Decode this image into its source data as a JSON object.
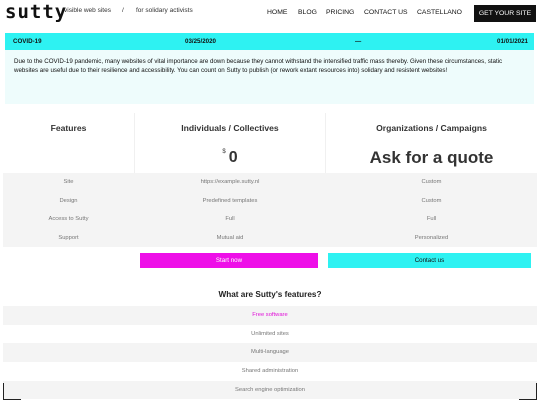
{
  "header": {
    "logo": "sutty",
    "tagline_1": "visible web sites",
    "tagline_sep": "/",
    "tagline_2": "for solidary activists",
    "nav": [
      "HOME",
      "BLOG",
      "PRICING",
      "CONTACT US",
      "CASTELLANO"
    ],
    "cta": "GET YOUR SITE"
  },
  "notice": {
    "title": "COVID-19",
    "start_date": "03/25/2020",
    "separator": "—",
    "end_date": "01/01/2021",
    "body": "Due to the COVID-19 pandemic, many websites of vital importance are down because they cannot withstand the intensified traffic mass thereby. Given these circumstances, static websites are useful due to their resilience and accessibility. You can count on Sutty to publish (or rework extant resources into) solidary and resistent websites!"
  },
  "pricing": {
    "col_features": "Features",
    "col_individuals": "Individuals / Collectives",
    "col_orgs": "Organizations / Campaigns",
    "currency": "$",
    "price_individuals": "0",
    "price_orgs": "Ask for a quote",
    "rows": [
      {
        "label": "Site",
        "individuals": "https://example.sutty.nl",
        "orgs": "Custom"
      },
      {
        "label": "Design",
        "individuals": "Predefined templates",
        "orgs": "Custom"
      },
      {
        "label": "Access to Sutty",
        "individuals": "Full",
        "orgs": "Full"
      },
      {
        "label": "Support",
        "individuals": "Mutual aid",
        "orgs": "Personalized"
      }
    ],
    "start_button": "Start now",
    "contact_button": "Contact us"
  },
  "features": {
    "title": "What are Sutty's features?",
    "items": [
      "Free software",
      "Unlimited sites",
      "Multi-language",
      "Shared administration",
      "Search engine optimization"
    ]
  },
  "colors": {
    "accent_cyan": "#2ef2f2",
    "accent_magenta": "#ee0fe8",
    "dark": "#111111"
  }
}
